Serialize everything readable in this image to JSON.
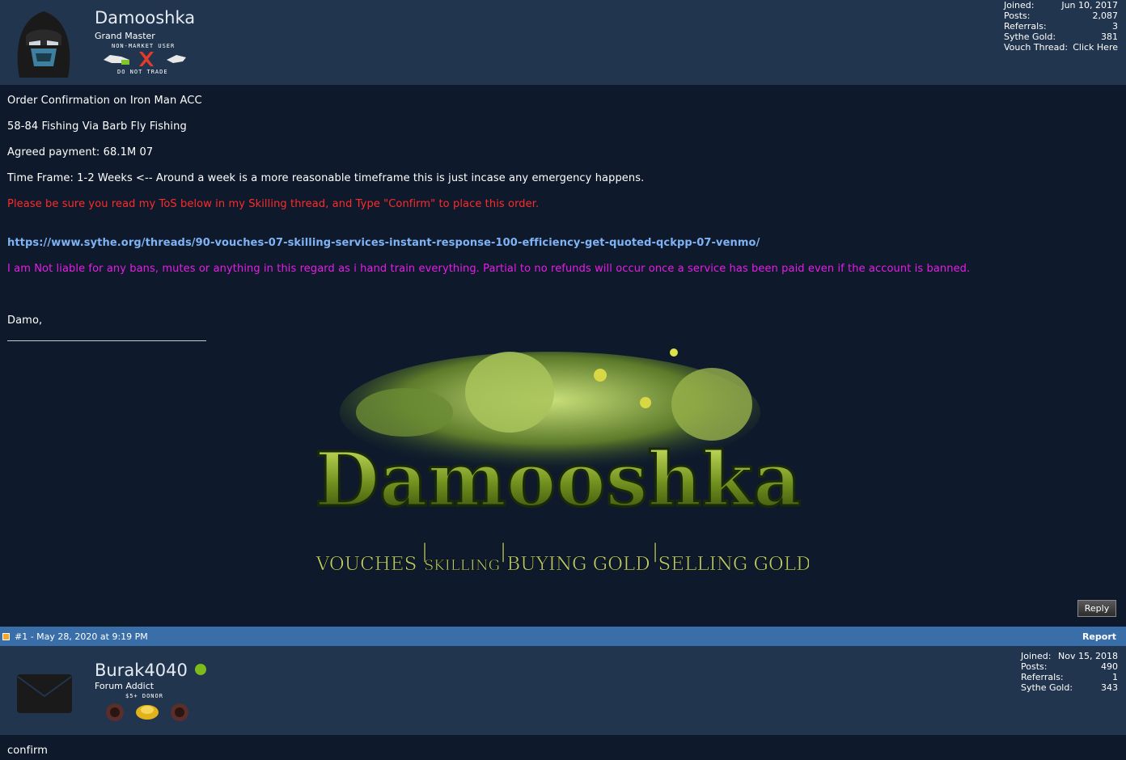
{
  "post1": {
    "username": "Damooshka",
    "rank": "Grand Master",
    "badge_top": "NON-MARKET USER",
    "badge_bottom": "DO NOT TRADE",
    "stats": [
      {
        "label": "Joined:",
        "value": "Jun 10, 2017"
      },
      {
        "label": "Posts:",
        "value": "2,087"
      },
      {
        "label": "Referrals:",
        "value": "3"
      },
      {
        "label": "Sythe Gold:",
        "value": "381"
      },
      {
        "label": "Vouch Thread:",
        "value": "Click Here"
      }
    ],
    "lines": {
      "l1": "Order Confirmation on Iron Man ACC",
      "l2": "58-84 Fishing Via Barb Fly Fishing",
      "l3": "Agreed payment: 68.1M 07",
      "l4": "Time Frame: 1-2 Weeks <-- Around a week is a more reasonable timeframe this is just incase any emergency happens.",
      "l5": "Please be sure you read my ToS below in my Skilling thread, and Type \"Confirm\" to place this order.",
      "link": "https://www.sythe.org/threads/90-vouches-07-skilling-services-instant-response-100-efficiency-get-quoted-qckpp-07-venmo/",
      "l6": "I am Not liable for any bans, mutes or anything in this regard as i hand train everything. Partial to no refunds will occur once a service has been paid even if the account is banned.",
      "sign": "Damo,"
    },
    "banner": {
      "logo": "Damooshka",
      "tagline": [
        "VOUCHES",
        "SKILLING",
        "BUYING GOLD",
        "SELLING GOLD"
      ]
    },
    "reply_label": "Reply"
  },
  "meta": {
    "postinfo": "#1 - May 28, 2020 at 9:19 PM",
    "report": "Report"
  },
  "post2": {
    "username": "Burak4040",
    "rank": "Forum Addict",
    "badge_caption": "$5+ DONOR",
    "stats": [
      {
        "label": "Joined:",
        "value": "Nov 15, 2018"
      },
      {
        "label": "Posts:",
        "value": "490"
      },
      {
        "label": "Referrals:",
        "value": "1"
      },
      {
        "label": "Sythe Gold:",
        "value": "343"
      }
    ],
    "body": "confirm"
  },
  "colors": {
    "header_bg": "#22354f",
    "page_bg": "#0e1a2b",
    "meta_bar": "#3a6ea8",
    "red_text": "#ff2a2a",
    "magenta_text": "#e81ce8",
    "link": "#7fb3f5",
    "online": "#7dbb1a"
  }
}
